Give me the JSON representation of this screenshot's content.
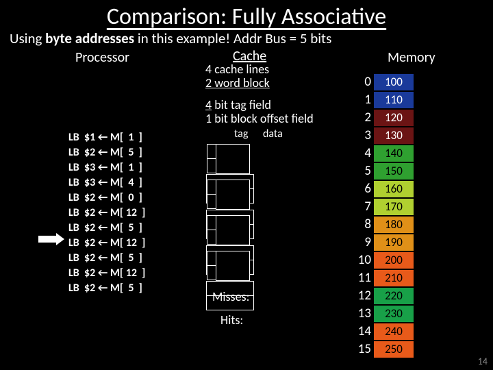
{
  "title": "Comparison: Fully Associative",
  "subtitle_pre": "Using ",
  "subtitle_bold": "byte addresses",
  "subtitle_post": " in this example! Addr Bus = 5 bits",
  "headings": {
    "processor": "Processor",
    "cache": "Cache",
    "memory": "Memory"
  },
  "cache_info": {
    "lines": "4 cache lines",
    "block": "2 word block",
    "tagfield_u": "4",
    "tagfield_rest": " bit tag field",
    "offset": "1 bit block offset field"
  },
  "cache_labels": {
    "tag": "tag",
    "data": "data"
  },
  "instructions": [
    {
      "op": "LB",
      "reg": "$1",
      "addr": "1"
    },
    {
      "op": "LB",
      "reg": "$2",
      "addr": "5"
    },
    {
      "op": "LB",
      "reg": "$3",
      "addr": "1"
    },
    {
      "op": "LB",
      "reg": "$3",
      "addr": "4"
    },
    {
      "op": "LB",
      "reg": "$2",
      "addr": "0"
    },
    {
      "op": "LB",
      "reg": "$2",
      "addr": "12"
    },
    {
      "op": "LB",
      "reg": "$2",
      "addr": "5"
    },
    {
      "op": "LB",
      "reg": "$2",
      "addr": "12"
    },
    {
      "op": "LB",
      "reg": "$2",
      "addr": "5"
    },
    {
      "op": "LB",
      "reg": "$2",
      "addr": "12"
    },
    {
      "op": "LB",
      "reg": "$2",
      "addr": "5"
    }
  ],
  "counters": {
    "misses_label": "Misses:",
    "hits_label": "Hits:"
  },
  "memory": [
    {
      "addr": "0",
      "val": "100",
      "bg": "#1a3a9a",
      "fg": "#fff"
    },
    {
      "addr": "1",
      "val": "110",
      "bg": "#1a3a9a",
      "fg": "#fff"
    },
    {
      "addr": "2",
      "val": "120",
      "bg": "#6b1414",
      "fg": "#fff"
    },
    {
      "addr": "3",
      "val": "130",
      "bg": "#6b1414",
      "fg": "#fff"
    },
    {
      "addr": "4",
      "val": "140",
      "bg": "#2fa030",
      "fg": "#000"
    },
    {
      "addr": "5",
      "val": "150",
      "bg": "#2fa030",
      "fg": "#000"
    },
    {
      "addr": "6",
      "val": "160",
      "bg": "#b0d030",
      "fg": "#000"
    },
    {
      "addr": "7",
      "val": "170",
      "bg": "#b0d030",
      "fg": "#000"
    },
    {
      "addr": "8",
      "val": "180",
      "bg": "#e09018",
      "fg": "#000"
    },
    {
      "addr": "9",
      "val": "190",
      "bg": "#e09018",
      "fg": "#000"
    },
    {
      "addr": "10",
      "val": "200",
      "bg": "#e85a1a",
      "fg": "#000"
    },
    {
      "addr": "11",
      "val": "210",
      "bg": "#e85a1a",
      "fg": "#000"
    },
    {
      "addr": "12",
      "val": "220",
      "bg": "#18a048",
      "fg": "#000"
    },
    {
      "addr": "13",
      "val": "230",
      "bg": "#18a048",
      "fg": "#000"
    },
    {
      "addr": "14",
      "val": "240",
      "bg": "#e85a1a",
      "fg": "#000"
    },
    {
      "addr": "15",
      "val": "250",
      "bg": "#e85a1a",
      "fg": "#000"
    }
  ],
  "slide_number": "14"
}
